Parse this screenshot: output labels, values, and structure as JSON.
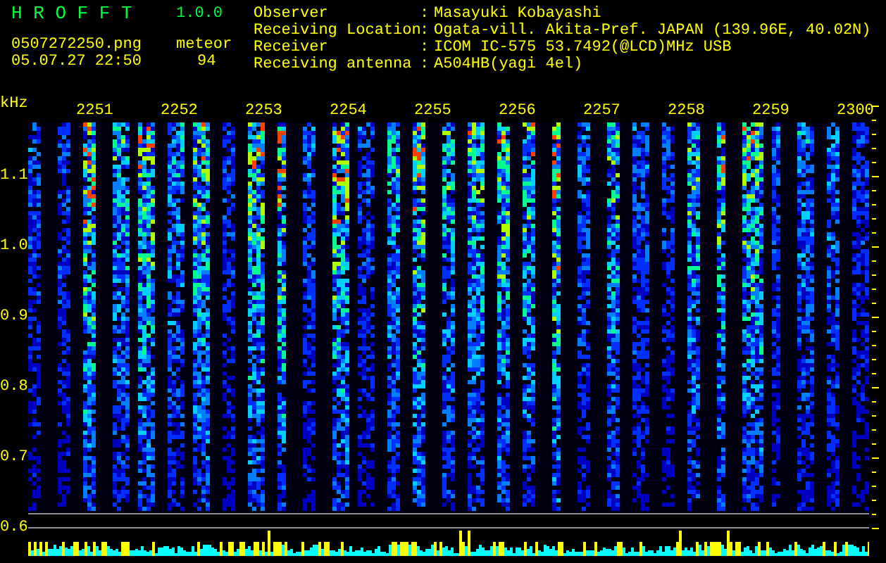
{
  "app": {
    "title": "H R O F F T",
    "version": "1.0.0",
    "file": "0507272250.png",
    "datetime": "05.07.27 22:50",
    "count_label": "meteor",
    "count": "94"
  },
  "info": [
    {
      "label": "Observer",
      "sep": ":",
      "value": "Masayuki Kobayashi"
    },
    {
      "label": "Receiving Location",
      "sep": ":",
      "value": "Ogata-vill. Akita-Pref. JAPAN (139.96E, 40.02N)"
    },
    {
      "label": "Receiver",
      "sep": ":",
      "value": "ICOM IC-575 53.7492(@LCD)MHz USB"
    },
    {
      "label": "Receiving antenna",
      "sep": ":",
      "value": "A504HB(yagi 4el)"
    }
  ],
  "spectrogram": {
    "unit": "kHz",
    "time_labels": [
      "2251",
      "2252",
      "2253",
      "2254",
      "2255",
      "2256",
      "2257",
      "2258",
      "2259",
      "2300"
    ],
    "freq_labels": [
      "1.1",
      "1.0",
      "0.9",
      "0.8",
      "0.7",
      "0.6"
    ]
  }
}
